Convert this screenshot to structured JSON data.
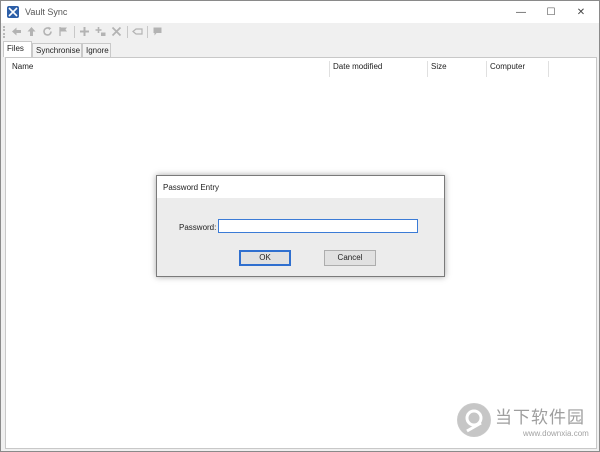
{
  "window": {
    "title": "Vault Sync",
    "minimize_glyph": "—",
    "maximize_glyph": "☐",
    "close_glyph": "✕"
  },
  "toolbar": {
    "buttons": [
      {
        "name": "back-arrow-icon"
      },
      {
        "name": "up-arrow-icon"
      },
      {
        "name": "refresh-icon"
      },
      {
        "name": "flag-icon"
      },
      {
        "name": "add-icon"
      },
      {
        "name": "add-folder-icon"
      },
      {
        "name": "delete-icon"
      },
      {
        "name": "tag-icon"
      },
      {
        "name": "comment-icon"
      }
    ]
  },
  "tabs": [
    {
      "label": "Files",
      "active": true
    },
    {
      "label": "Synchronise",
      "active": false
    },
    {
      "label": "Ignore",
      "active": false
    }
  ],
  "list": {
    "columns": [
      "Name",
      "Date modified",
      "Size",
      "Computer"
    ],
    "rows": []
  },
  "dialog": {
    "title": "Password Entry",
    "password_label": "Password:",
    "password_value": "",
    "ok_label": "OK",
    "cancel_label": "Cancel"
  },
  "watermark": {
    "text": "当下软件园",
    "url": "www.downxia.com"
  },
  "colors": {
    "accent": "#2f6fcf",
    "app_icon": "#2d5fa8"
  }
}
